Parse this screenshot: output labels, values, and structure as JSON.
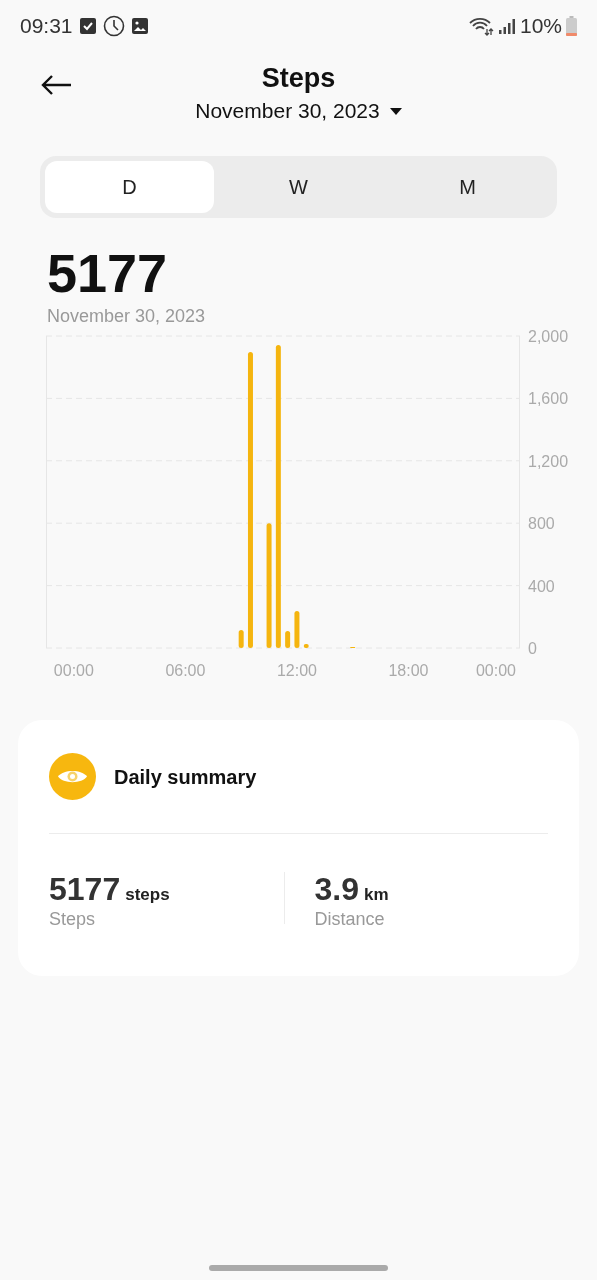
{
  "status_bar": {
    "time": "09:31",
    "battery": "10%"
  },
  "header": {
    "title": "Steps",
    "date": "November 30, 2023"
  },
  "tabs": [
    {
      "label": "D",
      "selected": true
    },
    {
      "label": "W",
      "selected": false
    },
    {
      "label": "M",
      "selected": false
    }
  ],
  "total": {
    "value": "5177",
    "date": "November 30, 2023"
  },
  "chart": {
    "chart_data": {
      "type": "bar",
      "grid": true,
      "x": [
        9,
        9.5,
        10.5,
        11,
        11.5,
        12,
        12.5,
        15
      ],
      "values": [
        115,
        1897,
        800,
        1942,
        109,
        237,
        26,
        6
      ],
      "xlim": [
        -1.5,
        24
      ],
      "ylim": [
        0,
        2000
      ],
      "xticks": [
        {
          "value": 0,
          "label": "00:00"
        },
        {
          "value": 6,
          "label": "06:00"
        },
        {
          "value": 12,
          "label": "12:00"
        },
        {
          "value": 18,
          "label": "18:00"
        },
        {
          "value": 24,
          "label": "00:00"
        }
      ],
      "yticks": [
        {
          "value": 0,
          "label": "0"
        },
        {
          "value": 400,
          "label": "400"
        },
        {
          "value": 800,
          "label": "800"
        },
        {
          "value": 1200,
          "label": "1,200"
        },
        {
          "value": 1600,
          "label": "1,600"
        },
        {
          "value": 2000,
          "label": "2,000"
        }
      ]
    }
  },
  "summary": {
    "title": "Daily summary",
    "stats": [
      {
        "value": "5177",
        "unit": "steps",
        "label": "Steps"
      },
      {
        "value": "3.9",
        "unit": "km",
        "label": "Distance"
      }
    ]
  }
}
